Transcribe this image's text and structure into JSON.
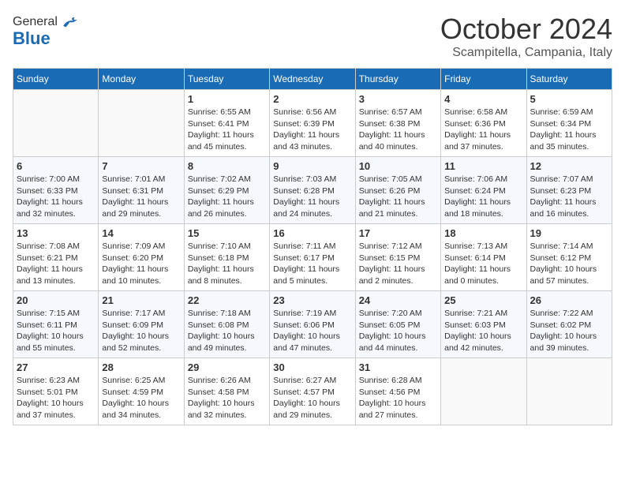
{
  "header": {
    "logo_line1": "General",
    "logo_line2": "Blue",
    "month_title": "October 2024",
    "location": "Scampitella, Campania, Italy"
  },
  "calendar": {
    "days_of_week": [
      "Sunday",
      "Monday",
      "Tuesday",
      "Wednesday",
      "Thursday",
      "Friday",
      "Saturday"
    ],
    "weeks": [
      [
        {
          "day": "",
          "info": ""
        },
        {
          "day": "",
          "info": ""
        },
        {
          "day": "1",
          "info": "Sunrise: 6:55 AM\nSunset: 6:41 PM\nDaylight: 11 hours and 45 minutes."
        },
        {
          "day": "2",
          "info": "Sunrise: 6:56 AM\nSunset: 6:39 PM\nDaylight: 11 hours and 43 minutes."
        },
        {
          "day": "3",
          "info": "Sunrise: 6:57 AM\nSunset: 6:38 PM\nDaylight: 11 hours and 40 minutes."
        },
        {
          "day": "4",
          "info": "Sunrise: 6:58 AM\nSunset: 6:36 PM\nDaylight: 11 hours and 37 minutes."
        },
        {
          "day": "5",
          "info": "Sunrise: 6:59 AM\nSunset: 6:34 PM\nDaylight: 11 hours and 35 minutes."
        }
      ],
      [
        {
          "day": "6",
          "info": "Sunrise: 7:00 AM\nSunset: 6:33 PM\nDaylight: 11 hours and 32 minutes."
        },
        {
          "day": "7",
          "info": "Sunrise: 7:01 AM\nSunset: 6:31 PM\nDaylight: 11 hours and 29 minutes."
        },
        {
          "day": "8",
          "info": "Sunrise: 7:02 AM\nSunset: 6:29 PM\nDaylight: 11 hours and 26 minutes."
        },
        {
          "day": "9",
          "info": "Sunrise: 7:03 AM\nSunset: 6:28 PM\nDaylight: 11 hours and 24 minutes."
        },
        {
          "day": "10",
          "info": "Sunrise: 7:05 AM\nSunset: 6:26 PM\nDaylight: 11 hours and 21 minutes."
        },
        {
          "day": "11",
          "info": "Sunrise: 7:06 AM\nSunset: 6:24 PM\nDaylight: 11 hours and 18 minutes."
        },
        {
          "day": "12",
          "info": "Sunrise: 7:07 AM\nSunset: 6:23 PM\nDaylight: 11 hours and 16 minutes."
        }
      ],
      [
        {
          "day": "13",
          "info": "Sunrise: 7:08 AM\nSunset: 6:21 PM\nDaylight: 11 hours and 13 minutes."
        },
        {
          "day": "14",
          "info": "Sunrise: 7:09 AM\nSunset: 6:20 PM\nDaylight: 11 hours and 10 minutes."
        },
        {
          "day": "15",
          "info": "Sunrise: 7:10 AM\nSunset: 6:18 PM\nDaylight: 11 hours and 8 minutes."
        },
        {
          "day": "16",
          "info": "Sunrise: 7:11 AM\nSunset: 6:17 PM\nDaylight: 11 hours and 5 minutes."
        },
        {
          "day": "17",
          "info": "Sunrise: 7:12 AM\nSunset: 6:15 PM\nDaylight: 11 hours and 2 minutes."
        },
        {
          "day": "18",
          "info": "Sunrise: 7:13 AM\nSunset: 6:14 PM\nDaylight: 11 hours and 0 minutes."
        },
        {
          "day": "19",
          "info": "Sunrise: 7:14 AM\nSunset: 6:12 PM\nDaylight: 10 hours and 57 minutes."
        }
      ],
      [
        {
          "day": "20",
          "info": "Sunrise: 7:15 AM\nSunset: 6:11 PM\nDaylight: 10 hours and 55 minutes."
        },
        {
          "day": "21",
          "info": "Sunrise: 7:17 AM\nSunset: 6:09 PM\nDaylight: 10 hours and 52 minutes."
        },
        {
          "day": "22",
          "info": "Sunrise: 7:18 AM\nSunset: 6:08 PM\nDaylight: 10 hours and 49 minutes."
        },
        {
          "day": "23",
          "info": "Sunrise: 7:19 AM\nSunset: 6:06 PM\nDaylight: 10 hours and 47 minutes."
        },
        {
          "day": "24",
          "info": "Sunrise: 7:20 AM\nSunset: 6:05 PM\nDaylight: 10 hours and 44 minutes."
        },
        {
          "day": "25",
          "info": "Sunrise: 7:21 AM\nSunset: 6:03 PM\nDaylight: 10 hours and 42 minutes."
        },
        {
          "day": "26",
          "info": "Sunrise: 7:22 AM\nSunset: 6:02 PM\nDaylight: 10 hours and 39 minutes."
        }
      ],
      [
        {
          "day": "27",
          "info": "Sunrise: 6:23 AM\nSunset: 5:01 PM\nDaylight: 10 hours and 37 minutes."
        },
        {
          "day": "28",
          "info": "Sunrise: 6:25 AM\nSunset: 4:59 PM\nDaylight: 10 hours and 34 minutes."
        },
        {
          "day": "29",
          "info": "Sunrise: 6:26 AM\nSunset: 4:58 PM\nDaylight: 10 hours and 32 minutes."
        },
        {
          "day": "30",
          "info": "Sunrise: 6:27 AM\nSunset: 4:57 PM\nDaylight: 10 hours and 29 minutes."
        },
        {
          "day": "31",
          "info": "Sunrise: 6:28 AM\nSunset: 4:56 PM\nDaylight: 10 hours and 27 minutes."
        },
        {
          "day": "",
          "info": ""
        },
        {
          "day": "",
          "info": ""
        }
      ]
    ]
  }
}
